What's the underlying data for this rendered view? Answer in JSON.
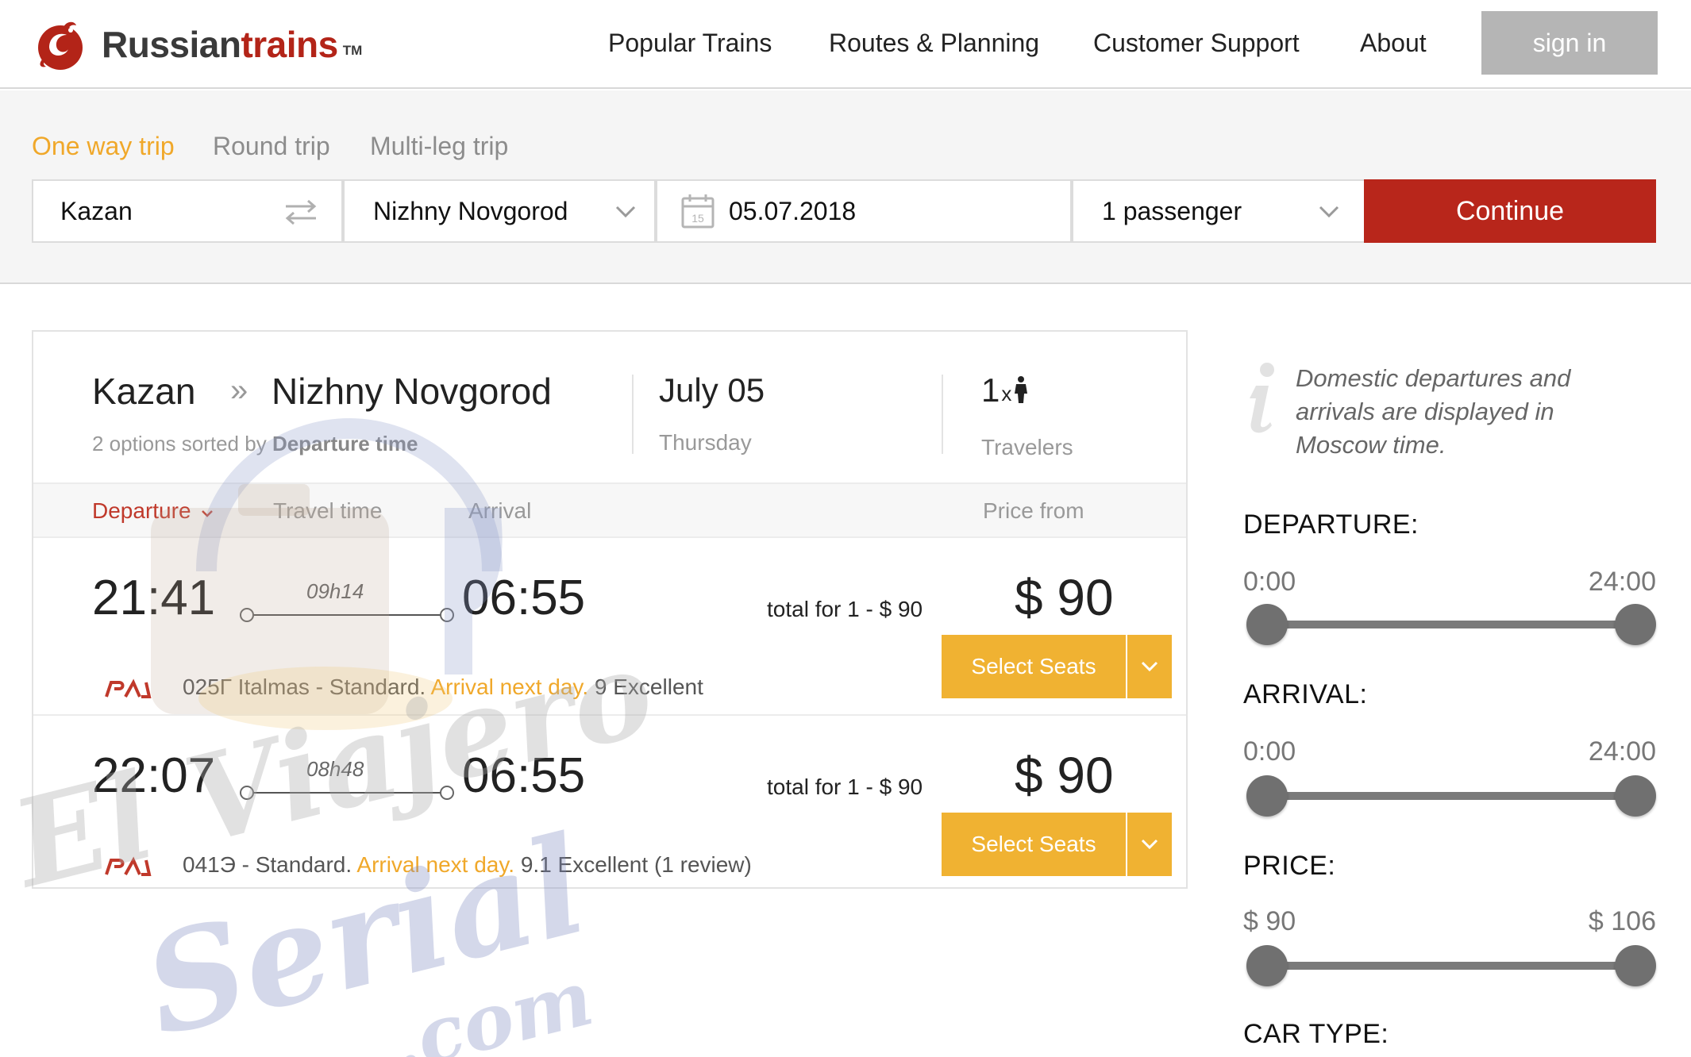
{
  "brand": {
    "name_part1": "Russian",
    "name_part2": "trains",
    "tm": "TM"
  },
  "nav": {
    "items": [
      {
        "label": "Popular Trains"
      },
      {
        "label": "Routes & Planning"
      },
      {
        "label": "Customer Support"
      },
      {
        "label": "About"
      }
    ],
    "signin_label": "sign in"
  },
  "search": {
    "trip_types": [
      {
        "label": "One way trip",
        "active": true
      },
      {
        "label": "Round trip",
        "active": false
      },
      {
        "label": "Multi-leg trip",
        "active": false
      }
    ],
    "from": "Kazan",
    "to": "Nizhny Novgorod",
    "date": "05.07.2018",
    "calendar_day": "15",
    "passengers": "1 passenger",
    "continue_label": "Continue"
  },
  "results": {
    "from_city": "Kazan",
    "arrow": "»",
    "to_city": "Nizhny Novgorod",
    "options_text": "2 options sorted by",
    "sort_field": "Departure time",
    "date_label": "July 05",
    "weekday": "Thursday",
    "travelers_count": "1",
    "travelers_x": "x",
    "travelers_label": "Travelers",
    "columns": {
      "departure": "Departure",
      "travel_time": "Travel time",
      "arrival": "Arrival",
      "price_from": "Price from"
    },
    "trains": [
      {
        "departure": "21:41",
        "duration": "09h14",
        "arrival": "06:55",
        "total": "total for 1 -  $ 90",
        "price": "$ 90",
        "select_label": "Select Seats",
        "info_main": "025Г Italmas - Standard. ",
        "info_orange": "Arrival next day.",
        "info_rating": " 9 Excellent"
      },
      {
        "departure": "22:07",
        "duration": "08h48",
        "arrival": "06:55",
        "total": "total for 1 -  $ 90",
        "price": "$ 90",
        "select_label": "Select Seats",
        "info_main": "041Э - Standard. ",
        "info_orange": "Arrival next day.",
        "info_rating": " 9.1 Excellent (1 review)"
      }
    ]
  },
  "sidebar": {
    "info_line1": "Domestic departures and",
    "info_line2": "arrivals are displayed in",
    "info_line3": "Moscow time.",
    "filters": [
      {
        "title": "DEPARTURE:",
        "min": "0:00",
        "max": "24:00"
      },
      {
        "title": "ARRIVAL:",
        "min": "0:00",
        "max": "24:00"
      },
      {
        "title": "PRICE:",
        "min": "$ 90",
        "max": "$ 106"
      }
    ],
    "car_type_title": "CAR TYPE:"
  },
  "watermark": {
    "line1": "El Viajero",
    "line2": "Serial",
    "line3": ".com"
  },
  "colors": {
    "brand_red": "#b8261b",
    "accent_orange": "#f0a82a",
    "select_button": "#f0b232",
    "signin_gray": "#b5b5b5"
  }
}
